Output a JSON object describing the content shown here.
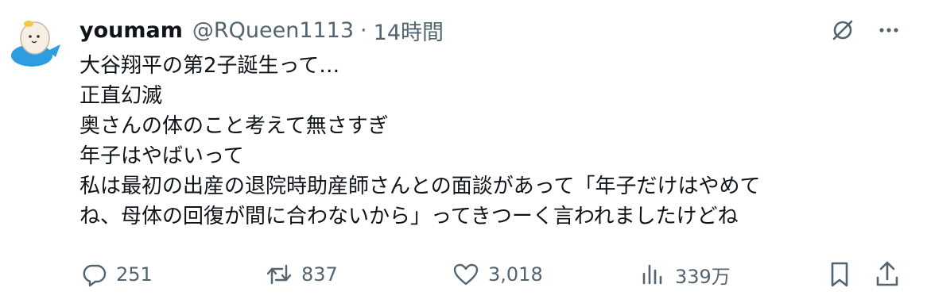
{
  "tweet": {
    "display_name": "youmam",
    "handle": "@RQueen1113",
    "separator": "·",
    "time": "14時間",
    "lines": [
      "大谷翔平の第2子誕生って…",
      "正直幻滅",
      "奥さんの体のこと考えて無さすぎ",
      "年子はやばいって",
      "私は最初の出産の退院時助産師さんとの面談があって「年子だけはやめて",
      "ね、母体の回復が間に合わないから」ってきつーく言われましたけどね"
    ]
  },
  "actions": {
    "replies": "251",
    "reposts": "837",
    "likes": "3,018",
    "views": "339万"
  },
  "colors": {
    "text": "#0f1419",
    "secondary": "#536471",
    "avatar_bg": "#2d9de2"
  },
  "icons": [
    "avatar",
    "grok-icon",
    "more-icon",
    "reply-icon",
    "repost-icon",
    "like-icon",
    "views-icon",
    "bookmark-icon",
    "share-icon"
  ]
}
